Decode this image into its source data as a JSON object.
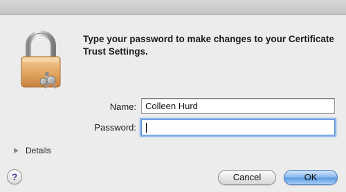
{
  "dialog": {
    "message": "Type your password to make changes to your Certificate Trust Settings.",
    "icon": "lock-icon"
  },
  "form": {
    "name_label": "Name:",
    "name_value": "Colleen Hurd",
    "password_label": "Password:",
    "password_value": ""
  },
  "details": {
    "label": "Details",
    "icon": "disclosure-triangle-icon"
  },
  "buttons": {
    "help_label": "?",
    "cancel_label": "Cancel",
    "ok_label": "OK"
  },
  "colors": {
    "window_bg": "#ececec",
    "focus_ring": "#8fb6ea",
    "default_button": "#5e9de3"
  }
}
